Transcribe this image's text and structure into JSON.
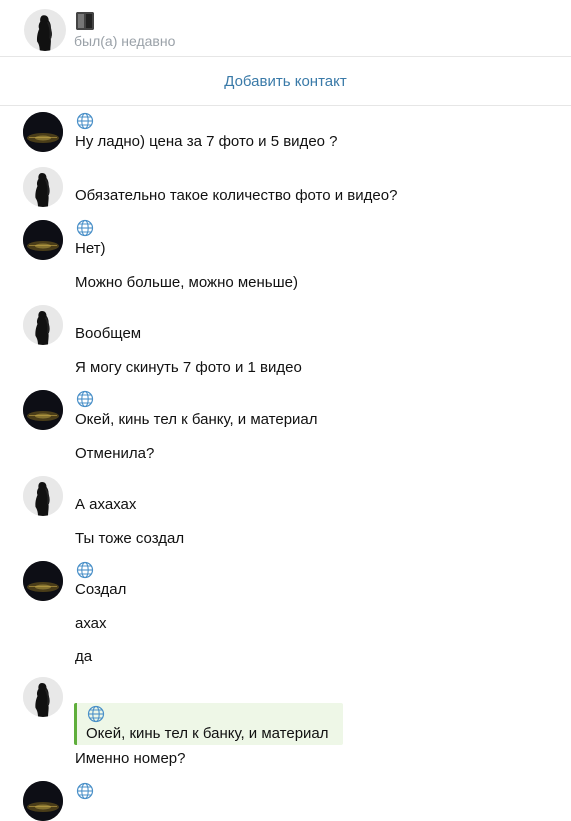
{
  "header": {
    "status": "был(а) недавно"
  },
  "add_contact_label": "Добавить контакт",
  "messages": [
    {
      "text": "Ну ладно) цена за 7 фото и 5 видео ?"
    },
    {
      "text": "Обязательно такое количество фото и видео?"
    },
    {
      "text": "Нет)"
    },
    {
      "text": "Можно больше, можно меньше)"
    },
    {
      "text": "Вообщем"
    },
    {
      "text": "Я могу скинуть 7 фото и 1 видео"
    },
    {
      "text": "Окей, кинь тел к банку, и материал"
    },
    {
      "text": "Отменила?"
    },
    {
      "text": "А ахахах"
    },
    {
      "text": "Ты тоже создал"
    },
    {
      "text": "Создал"
    },
    {
      "text": "ахах"
    },
    {
      "text": "да"
    },
    {
      "text": "Именно номер?"
    }
  ],
  "quote": {
    "text": "Окей, кинь тел к банку, и материал"
  },
  "icons": {
    "globe": "globe-icon",
    "girl_avatar": "avatar-girl",
    "city_avatar": "avatar-city-night"
  }
}
